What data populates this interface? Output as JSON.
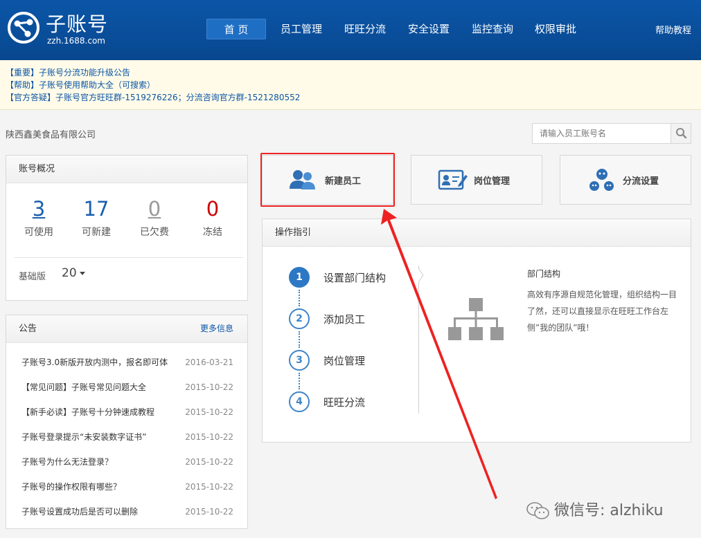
{
  "header": {
    "logo_title": "子账号",
    "logo_domain": "zzh.1688.com",
    "nav": [
      "首 页",
      "员工管理",
      "旺旺分流",
      "安全设置",
      "监控查询",
      "权限审批"
    ],
    "active_index": 0,
    "help_label": "帮助教程",
    "brand_color": "#0b56a8"
  },
  "notices": [
    "【重要】子账号分流功能升级公告",
    "【帮助】子账号使用帮助大全（可搜索）",
    "【官方答疑】子账号官方旺旺群-1519276226；分流咨询官方群-1521280552"
  ],
  "company_name": "陕西鑫美食品有限公司",
  "search": {
    "placeholder": "请输入员工账号名",
    "icon": "search-icon"
  },
  "overview": {
    "title": "账号概况",
    "stats": [
      {
        "value": "3",
        "label": "可使用",
        "color": "#1a5fae"
      },
      {
        "value": "17",
        "label": "可新建",
        "color": "#1a5fae"
      },
      {
        "value": "0",
        "label": "已欠费",
        "color": "#999999"
      },
      {
        "value": "0",
        "label": "冻结",
        "color": "#cc0000"
      }
    ],
    "edition_label": "基础版",
    "edition_count": "20"
  },
  "announcements": {
    "title": "公告",
    "more_label": "更多信息",
    "items": [
      {
        "title": "子账号3.0新版开放内测中，报名即可体",
        "date": "2016-03-21"
      },
      {
        "title": "【常见问题】子账号常见问题大全",
        "date": "2015-10-22"
      },
      {
        "title": "【新手必读】子账号十分钟速成教程",
        "date": "2015-10-22"
      },
      {
        "title": "子账号登录提示“未安装数字证书”",
        "date": "2015-10-22"
      },
      {
        "title": "子账号为什么无法登录？",
        "date": "2015-10-22"
      },
      {
        "title": "子账号的操作权限有哪些？",
        "date": "2015-10-22"
      },
      {
        "title": "子账号设置成功后是否可以删除",
        "date": "2015-10-22"
      }
    ]
  },
  "actions": [
    {
      "label": "新建员工",
      "icon": "users-icon"
    },
    {
      "label": "岗位管理",
      "icon": "id-card-edit-icon"
    },
    {
      "label": "分流设置",
      "icon": "diversion-icon"
    }
  ],
  "guide": {
    "title": "操作指引",
    "steps": [
      {
        "num": "1",
        "label": "设置部门结构"
      },
      {
        "num": "2",
        "label": "添加员工"
      },
      {
        "num": "3",
        "label": "岗位管理"
      },
      {
        "num": "4",
        "label": "旺旺分流"
      }
    ],
    "active_step": 0,
    "desc_title": "部门结构",
    "desc_text": "高效有序源自规范化管理，组织结构一目了然，还可以直接显示在旺旺工作台左侧”我的团队”哦！",
    "desc_icon": "org-chart-icon"
  },
  "watermark": "微信号: alzhiku",
  "accent_red": "#ee2222"
}
